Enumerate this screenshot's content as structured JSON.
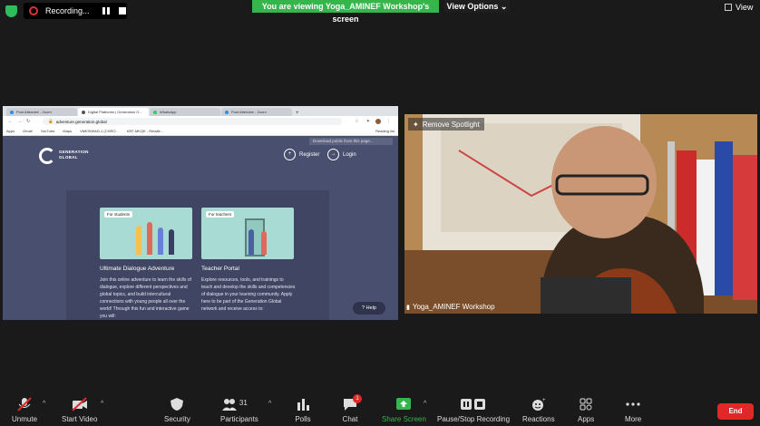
{
  "top": {
    "recording_label": "Recording...",
    "viewing_banner": "You are viewing Yoga_AMINEF Workshop's screen",
    "view_options": "View Options",
    "view_button": "View"
  },
  "browser": {
    "tabs": [
      {
        "label": "Post Attendee - Zoom",
        "color": "#2d8cff"
      },
      {
        "label": "Digital Platforms | Generation G...",
        "color": "#555555"
      },
      {
        "label": "WhatsApp",
        "color": "#25d366"
      },
      {
        "label": "Post Attendee - Zoom",
        "color": "#2d8cff"
      }
    ],
    "new_tab": "+",
    "url": "adventure.generation.global",
    "bookmarks": [
      "Apps",
      "Gmail",
      "YouTube",
      "Maps",
      "VMKSIWAD-1 (CHRO...",
      "KEF-MKQK - Retaile..."
    ],
    "reading_list": "Reading list",
    "download_note": "Download public from this page..."
  },
  "site": {
    "logo_text": "GENERATION GLOBAL",
    "register": "Register",
    "login": "Login",
    "students_tag": "For students",
    "teachers_tag": "For teachers",
    "students_title": "Ultimate Dialogue Adventure",
    "students_body": "Join this online adventure to learn the skills of dialogue, explore different perspectives and global topics, and build intercultural connections with young people all over the world! Through this fun and interactive game you will:",
    "teachers_title": "Teacher Portal",
    "teachers_body": "Explore resources, tools, and trainings to teach and develop the skills and competencies of dialogue in your learning community. Apply here to be part of the Generation Global network and receive access to:",
    "help": "Help"
  },
  "video": {
    "remove_spotlight": "Remove Spotlight",
    "participant_name": "Yoga_AMINEF Workshop"
  },
  "toolbar": {
    "unmute": "Unmute",
    "start_video": "Start Video",
    "security": "Security",
    "participants": "Participants",
    "participants_count": "31",
    "polls": "Polls",
    "chat": "Chat",
    "chat_badge": "1",
    "share_screen": "Share Screen",
    "pause_stop_recording": "Pause/Stop Recording",
    "reactions": "Reactions",
    "apps": "Apps",
    "more": "More",
    "end": "End"
  },
  "colors": {
    "share_green": "#35b54a",
    "end_red": "#e02828",
    "site_bg": "#49506f"
  }
}
